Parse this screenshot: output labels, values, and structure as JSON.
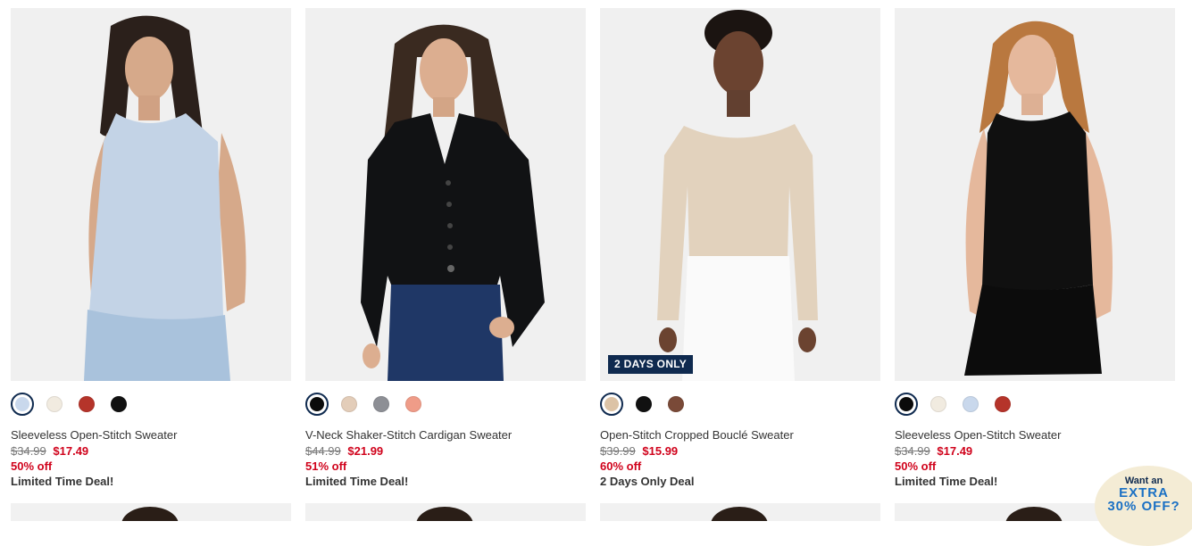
{
  "products": [
    {
      "name": "Sleeveless Open-Stitch Sweater",
      "original_price": "$34.99",
      "sale_price": "$17.49",
      "discount": "50% off",
      "deal": "Limited Time Deal!",
      "badge": "",
      "swatches": [
        "#c9d8ec",
        "#f1ebe0",
        "#b5342a",
        "#111111"
      ],
      "selected_swatch": 0
    },
    {
      "name": "V-Neck Shaker-Stitch Cardigan Sweater",
      "original_price": "$44.99",
      "sale_price": "$21.99",
      "discount": "51% off",
      "deal": "Limited Time Deal!",
      "badge": "",
      "swatches": [
        "#0b0b0b",
        "#e3cdb9",
        "#8d8f95",
        "#ef9c88"
      ],
      "selected_swatch": 0
    },
    {
      "name": "Open-Stitch Cropped Bouclé Sweater",
      "original_price": "$39.99",
      "sale_price": "$15.99",
      "discount": "60% off",
      "deal": "2 Days Only Deal",
      "badge": "2 DAYS ONLY",
      "swatches": [
        "#dcc3a6",
        "#111111",
        "#7a4a38"
      ],
      "selected_swatch": 0
    },
    {
      "name": "Sleeveless Open-Stitch Sweater",
      "original_price": "$34.99",
      "sale_price": "$17.49",
      "discount": "50% off",
      "deal": "Limited Time Deal!",
      "badge": "",
      "swatches": [
        "#0b0b0b",
        "#f1ebe0",
        "#c9d8ec",
        "#b5342a"
      ],
      "selected_swatch": 0
    }
  ],
  "promo": {
    "line1": "Want an",
    "line2": "EXTRA",
    "line3": "30% OFF?"
  },
  "colors": {
    "sale_red": "#d0021b",
    "badge_navy": "#0f2a4f",
    "promo_blue": "#1a70c4"
  }
}
